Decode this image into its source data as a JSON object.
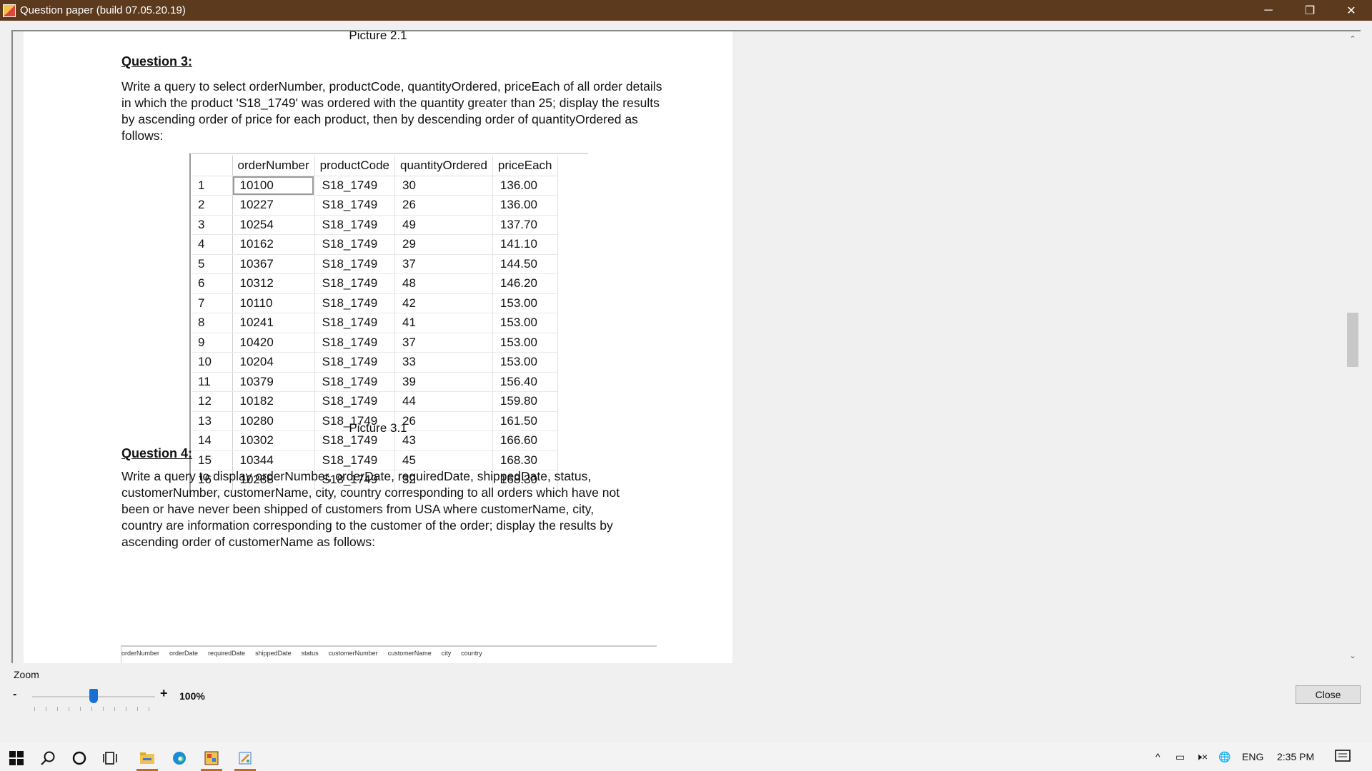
{
  "window": {
    "title": "Question paper (build 07.05.20.19)",
    "minimize_glyph": "─",
    "restore_glyph": "❐",
    "close_glyph": "✕"
  },
  "document": {
    "top_caption": "Picture 2.1",
    "q3": {
      "heading": "Question 3:",
      "text": "Write a query to select orderNumber, productCode, quantityOrdered, priceEach of all order details in which the product 'S18_1749' was ordered with the quantity greater than 25; display the results by ascending order of price for each product, then by descending order of quantityOrdered as follows:"
    },
    "grid": {
      "columns": [
        "orderNumber",
        "productCode",
        "quantityOrdered",
        "priceEach"
      ],
      "rows": [
        [
          "1",
          "10100",
          "S18_1749",
          "30",
          "136.00"
        ],
        [
          "2",
          "10227",
          "S18_1749",
          "26",
          "136.00"
        ],
        [
          "3",
          "10254",
          "S18_1749",
          "49",
          "137.70"
        ],
        [
          "4",
          "10162",
          "S18_1749",
          "29",
          "141.10"
        ],
        [
          "5",
          "10367",
          "S18_1749",
          "37",
          "144.50"
        ],
        [
          "6",
          "10312",
          "S18_1749",
          "48",
          "146.20"
        ],
        [
          "7",
          "10110",
          "S18_1749",
          "42",
          "153.00"
        ],
        [
          "8",
          "10241",
          "S18_1749",
          "41",
          "153.00"
        ],
        [
          "9",
          "10420",
          "S18_1749",
          "37",
          "153.00"
        ],
        [
          "10",
          "10204",
          "S18_1749",
          "33",
          "153.00"
        ],
        [
          "11",
          "10379",
          "S18_1749",
          "39",
          "156.40"
        ],
        [
          "12",
          "10182",
          "S18_1749",
          "44",
          "159.80"
        ],
        [
          "13",
          "10280",
          "S18_1749",
          "26",
          "161.50"
        ],
        [
          "14",
          "10302",
          "S18_1749",
          "43",
          "166.60"
        ],
        [
          "15",
          "10344",
          "S18_1749",
          "45",
          "168.30"
        ],
        [
          "16",
          "10288",
          "S18_1749",
          "32",
          "168.30"
        ]
      ]
    },
    "caption_3": "Picture 3.1",
    "q4": {
      "heading": "Question 4:",
      "line1": "Write a query to display orderNumber, orderDate, requiredDate, shippedDate, status,",
      "line2": "customerNumber, customerName, city, country corresponding to all orders which have not",
      "line3": "been or have never been shipped of customers from USA where customerName, city,",
      "line4": "country are information corresponding to the customer of the order; display the results by",
      "line5": "ascending order of customerName as follows:"
    },
    "grid2_columns": [
      "orderNumber",
      "orderDate",
      "requiredDate",
      "shippedDate",
      "status",
      "customerNumber",
      "customerName",
      "city",
      "country"
    ]
  },
  "zoom": {
    "label": "Zoom",
    "minus": "-",
    "plus": "+",
    "value": "100%",
    "level_fraction": 0.5
  },
  "close_button": "Close",
  "taskbar": {
    "language": "ENG",
    "time": "2:35 PM"
  }
}
